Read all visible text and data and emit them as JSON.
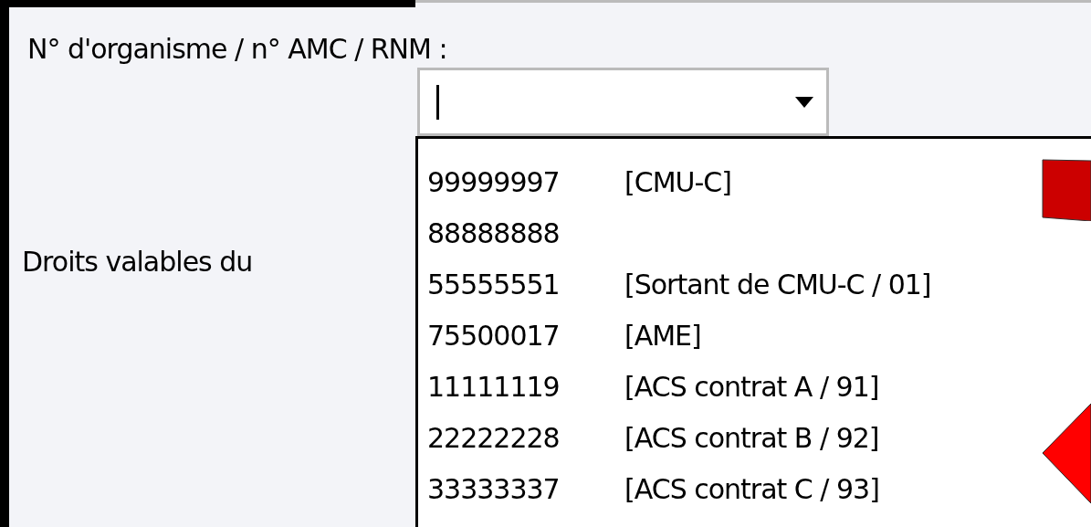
{
  "form": {
    "organism_label": "N° d'organisme / n° AMC / RNM :",
    "rights_label": "Droits valables du"
  },
  "combo": {
    "expanded": true
  },
  "options": [
    {
      "code": "99999997",
      "label": "[CMU-C]"
    },
    {
      "code": "88888888"
    },
    {
      "code": "55555551",
      "label": "[Sortant de CMU-C / 01]"
    },
    {
      "code": "75500017",
      "label": "[AME]"
    },
    {
      "code": "11111119",
      "label": "[ACS contrat A / 91]"
    },
    {
      "code": "22222228",
      "label": "[ACS contrat B / 92]"
    },
    {
      "code": "33333337",
      "label": "[ACS contrat C / 93]"
    }
  ]
}
